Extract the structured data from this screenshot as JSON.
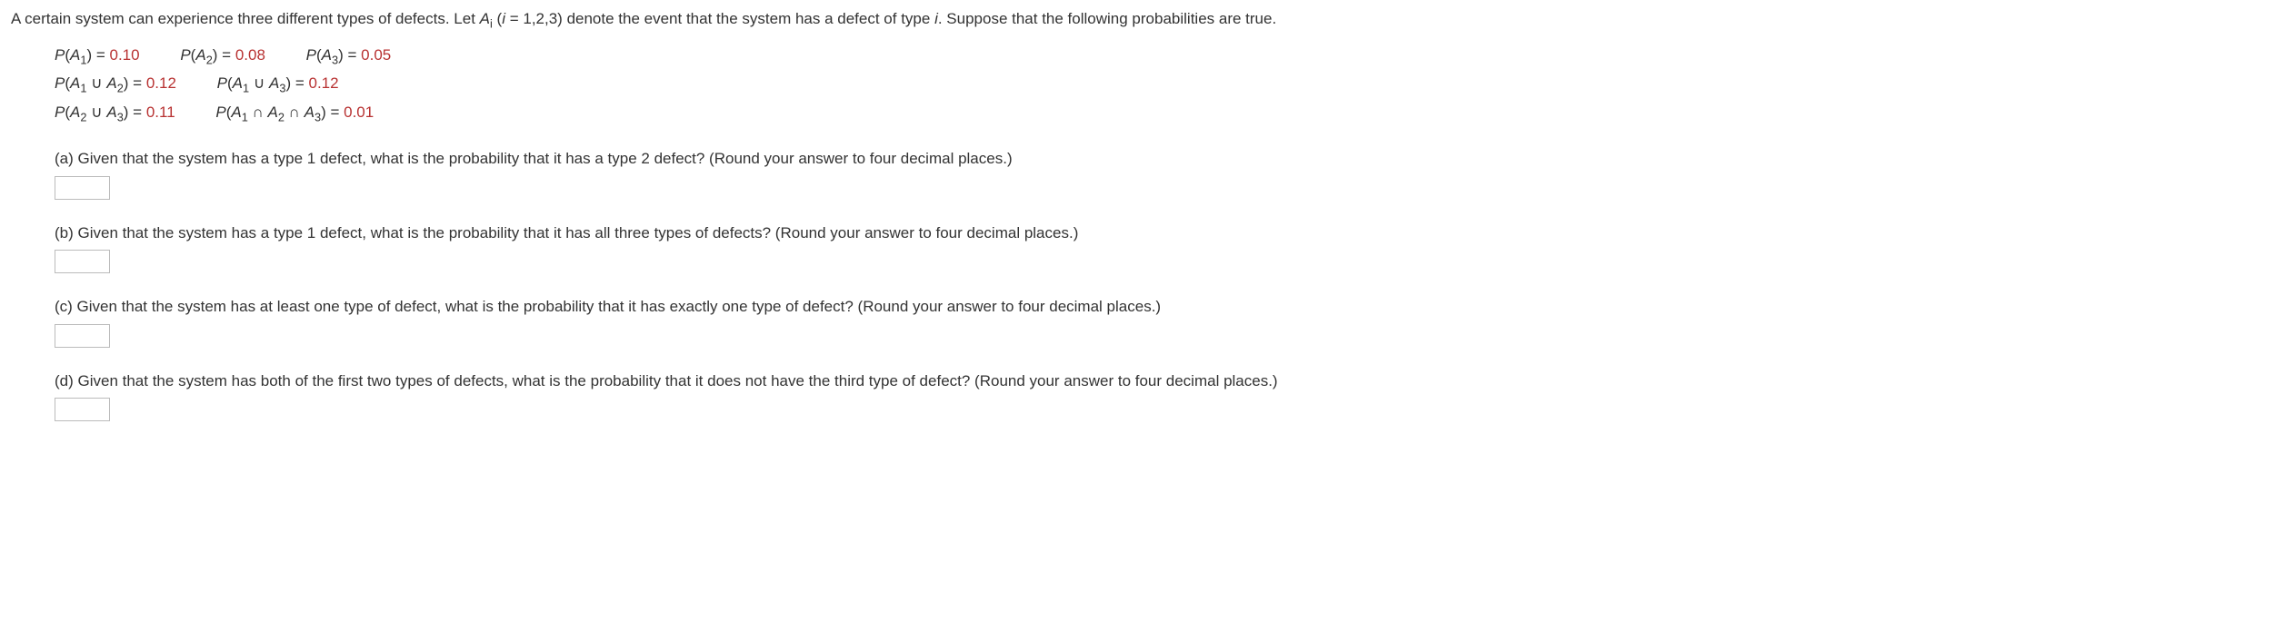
{
  "intro": {
    "pre": "A certain system can experience three different types of defects. Let ",
    "var": "A",
    "sub": "i",
    "mid": " (",
    "ivar": "i",
    "post": " = 1,2,3) denote the event that the system has a defect of type ",
    "ivar2": "i",
    "end": ". Suppose that the following probabilities are true."
  },
  "probs": {
    "p1": {
      "label_pre": "P",
      "label_var": "A",
      "label_sub": "1",
      "label_post": ") = ",
      "val": "0.10"
    },
    "p2": {
      "label_pre": "P",
      "label_var": "A",
      "label_sub": "2",
      "label_post": ") = ",
      "val": "0.08"
    },
    "p3": {
      "label_pre": "P",
      "label_var": "A",
      "label_sub": "3",
      "label_post": ") = ",
      "val": "0.05"
    },
    "u12": {
      "a": "A",
      "as": "1",
      "b": "A",
      "bs": "2",
      "op": " ∪ ",
      "eq": ") = ",
      "val": "0.12"
    },
    "u13": {
      "a": "A",
      "as": "1",
      "b": "A",
      "bs": "3",
      "op": " ∪ ",
      "eq": ") = ",
      "val": "0.12"
    },
    "u23": {
      "a": "A",
      "as": "2",
      "b": "A",
      "bs": "3",
      "op": " ∪ ",
      "eq": ") = ",
      "val": "0.11"
    },
    "i123": {
      "a": "A",
      "as": "1",
      "b": "A",
      "bs": "2",
      "c": "A",
      "cs": "3",
      "op": " ∩ ",
      "eq": ") = ",
      "val": "0.01"
    },
    "P": "P",
    "open": "("
  },
  "qa": {
    "text": "(a) Given that the system has a type 1 defect, what is the probability that it has a type 2 defect? (Round your answer to four decimal places.)"
  },
  "qb": {
    "text": "(b) Given that the system has a type 1 defect, what is the probability that it has all three types of defects? (Round your answer to four decimal places.)"
  },
  "qc": {
    "text": "(c) Given that the system has at least one type of defect, what is the probability that it has exactly one type of defect? (Round your answer to four decimal places.)"
  },
  "qd": {
    "text": "(d) Given that the system has both of the first two types of defects, what is the probability that it does not have the third type of defect? (Round your answer to four decimal places.)"
  }
}
